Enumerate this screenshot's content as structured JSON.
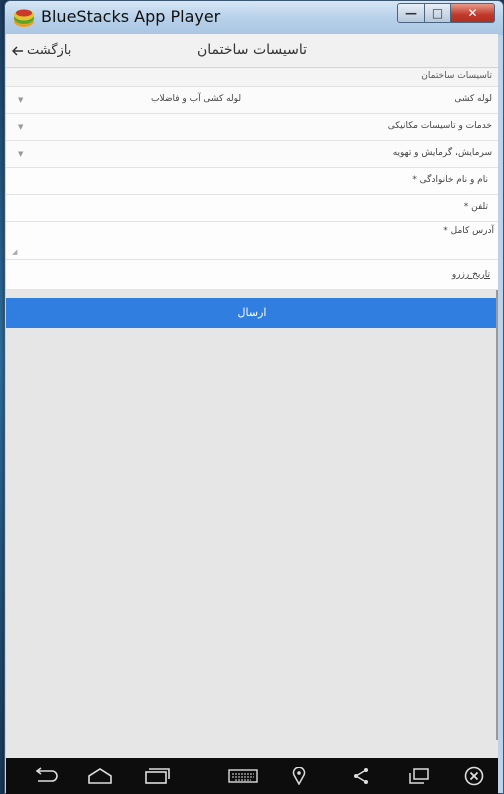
{
  "window": {
    "title": "BlueStacks App Player",
    "controls": {
      "minimize": "—",
      "maximize": "□",
      "close": "✕"
    }
  },
  "header": {
    "back_label": "بازگشت",
    "title": "تاسیسات ساختمان"
  },
  "form": {
    "section_label": "تاسیسات ساختمان",
    "rows": [
      {
        "label": "لوله کشی",
        "value": "لوله کشی آب و فاضلاب"
      },
      {
        "label": "خدمات و تاسیسات مکانیکی",
        "value": ""
      },
      {
        "label": "سرمایش، گرمایش و تهویه",
        "value": ""
      }
    ],
    "name_field": "نام و نام خانوادگی *",
    "phone_field": "تلفن *",
    "address_field": "آدرس کامل *",
    "date_field": "تاریخ رزرو",
    "submit_label": "ارسال"
  },
  "navbar": {
    "icons": [
      "back-icon",
      "home-icon",
      "recent-apps-icon",
      "keyboard-icon",
      "location-icon",
      "share-icon",
      "window-icon",
      "close-icon"
    ]
  },
  "colors": {
    "accent": "#2f7ee0",
    "navbar": "#0d0d0d",
    "app_background": "#e6e6e6"
  }
}
